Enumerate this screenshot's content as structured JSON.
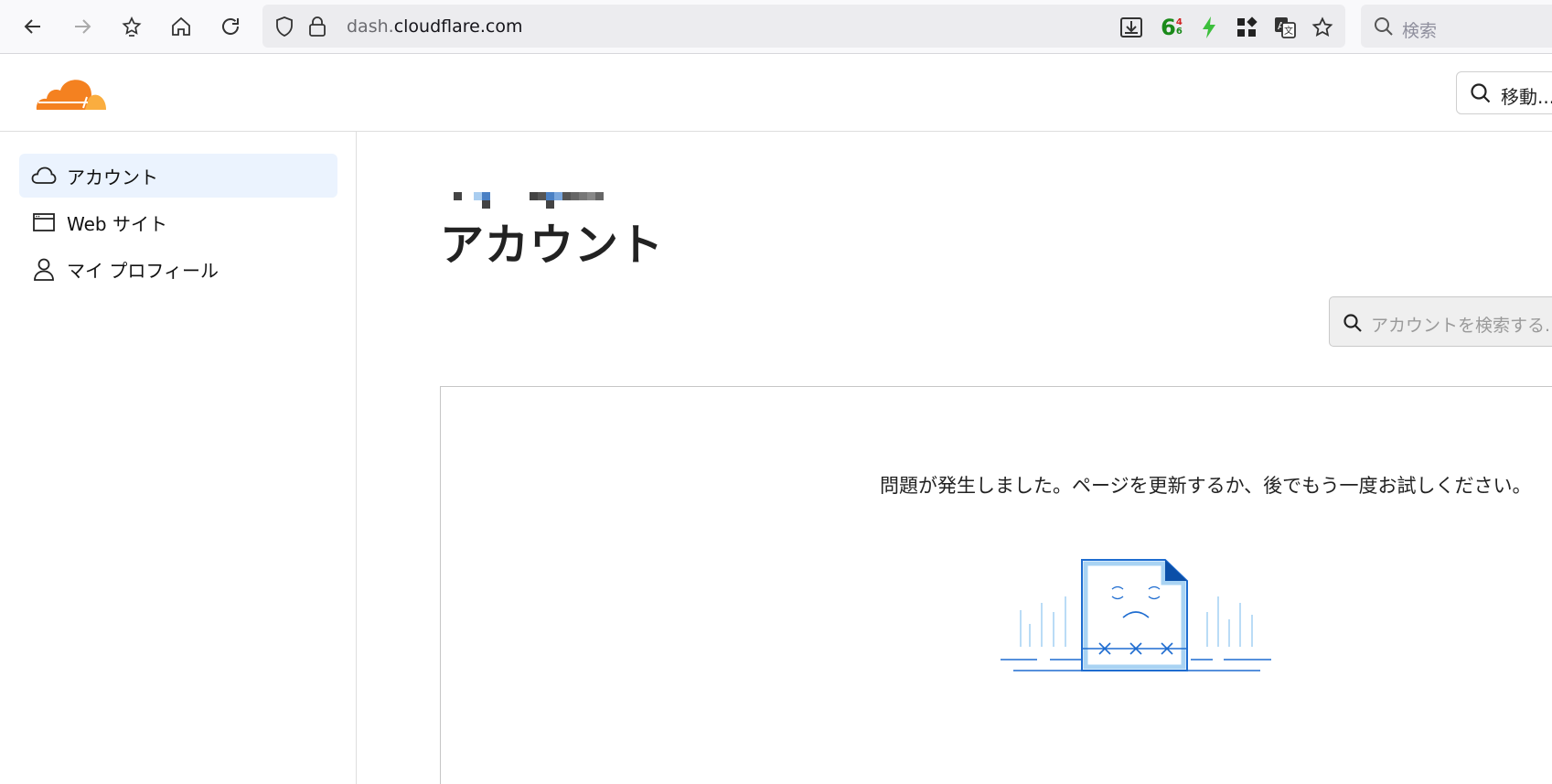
{
  "browser": {
    "url_prefix": "dash.",
    "url_domain": "cloudflare.com",
    "search_placeholder": "検索",
    "ext_badge_main": "6",
    "ext_badge_top": "4",
    "ext_badge_bottom": "6"
  },
  "header": {
    "goto_label": "移動..."
  },
  "sidebar": {
    "items": [
      {
        "label": "アカウント",
        "icon": "cloud-icon",
        "active": true
      },
      {
        "label": "Web サイト",
        "icon": "browser-window-icon",
        "active": false
      },
      {
        "label": "マイ プロフィール",
        "icon": "user-icon",
        "active": false
      }
    ]
  },
  "main": {
    "title": "アカウント",
    "search_placeholder": "アカウントを検索する...",
    "error_message": "問題が発生しました。ページを更新するか、後でもう一度お試しください。"
  },
  "colors": {
    "brand_orange": "#f48120",
    "brand_orange_light": "#faad3f",
    "active_bg": "#ebf3fe",
    "illustration_blue": "#1e6cd0",
    "illustration_light": "#a9d3f3"
  }
}
